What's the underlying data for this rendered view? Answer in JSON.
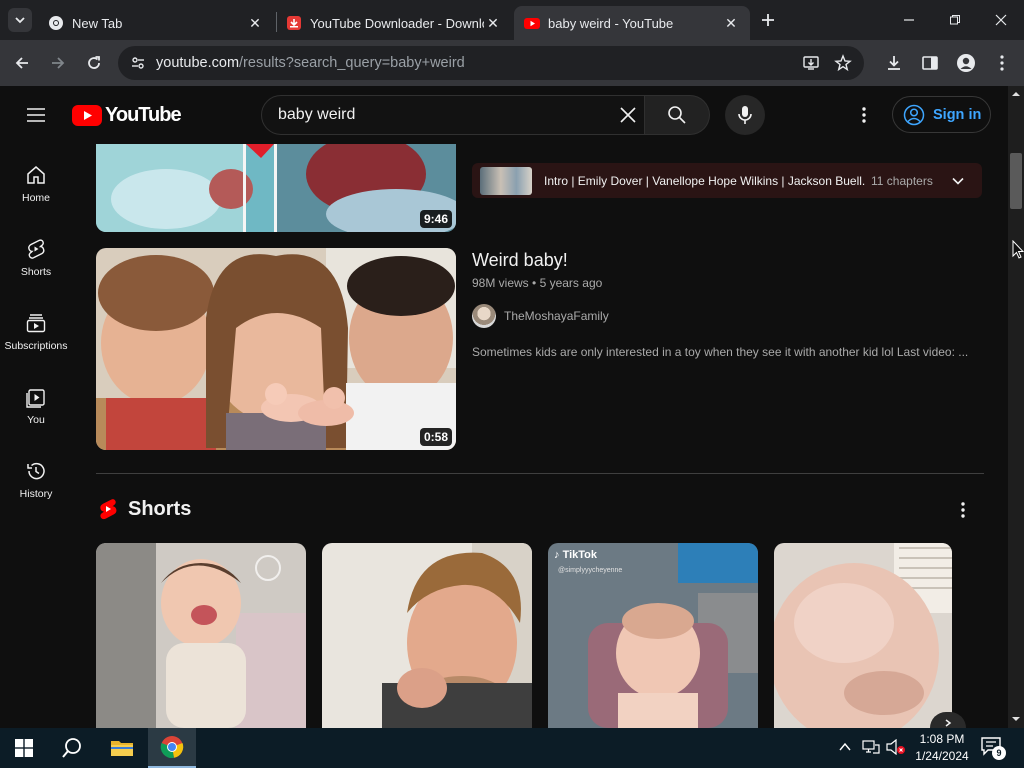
{
  "browser": {
    "tabs": [
      {
        "title": "New Tab",
        "active": false
      },
      {
        "title": "YouTube Downloader - Downlo",
        "active": false
      },
      {
        "title": "baby weird - YouTube",
        "active": true
      }
    ],
    "url_host": "youtube.com",
    "url_path": "/results?search_query=baby+weird"
  },
  "youtube": {
    "logo_text": "YouTube",
    "search_value": "baby weird",
    "sign_in_label": "Sign in",
    "nav": [
      {
        "label": "Home",
        "icon": "home-icon"
      },
      {
        "label": "Shorts",
        "icon": "shorts-icon"
      },
      {
        "label": "Subscriptions",
        "icon": "subscriptions-icon"
      },
      {
        "label": "You",
        "icon": "you-icon"
      },
      {
        "label": "History",
        "icon": "history-icon"
      }
    ],
    "prev_video": {
      "duration": "9:46",
      "chapters_text": "Intro | Emily Dover | Vanellope Hope Wilkins | Jackson Buell...",
      "chapters_count": "11 chapters"
    },
    "video": {
      "title": "Weird baby!",
      "views": "98M views",
      "age": "5 years ago",
      "channel": "TheMoshayaFamily",
      "description": "Sometimes kids are only interested in a toy when they see it with another kid lol Last video: ...",
      "duration": "0:58"
    },
    "shorts": {
      "title": "Shorts",
      "items": [
        {
          "overlay": "",
          "accent": "#c9c4bf"
        },
        {
          "overlay": "",
          "accent": "#e7e3dc"
        },
        {
          "overlay": "TikTok",
          "sub": "@simplyyycheyenne",
          "accent": "#8a9aa5"
        },
        {
          "overlay": "",
          "accent": "#d8d0c8"
        }
      ]
    }
  },
  "taskbar": {
    "time": "1:08 PM",
    "date": "1/24/2024",
    "notifications": "9"
  }
}
